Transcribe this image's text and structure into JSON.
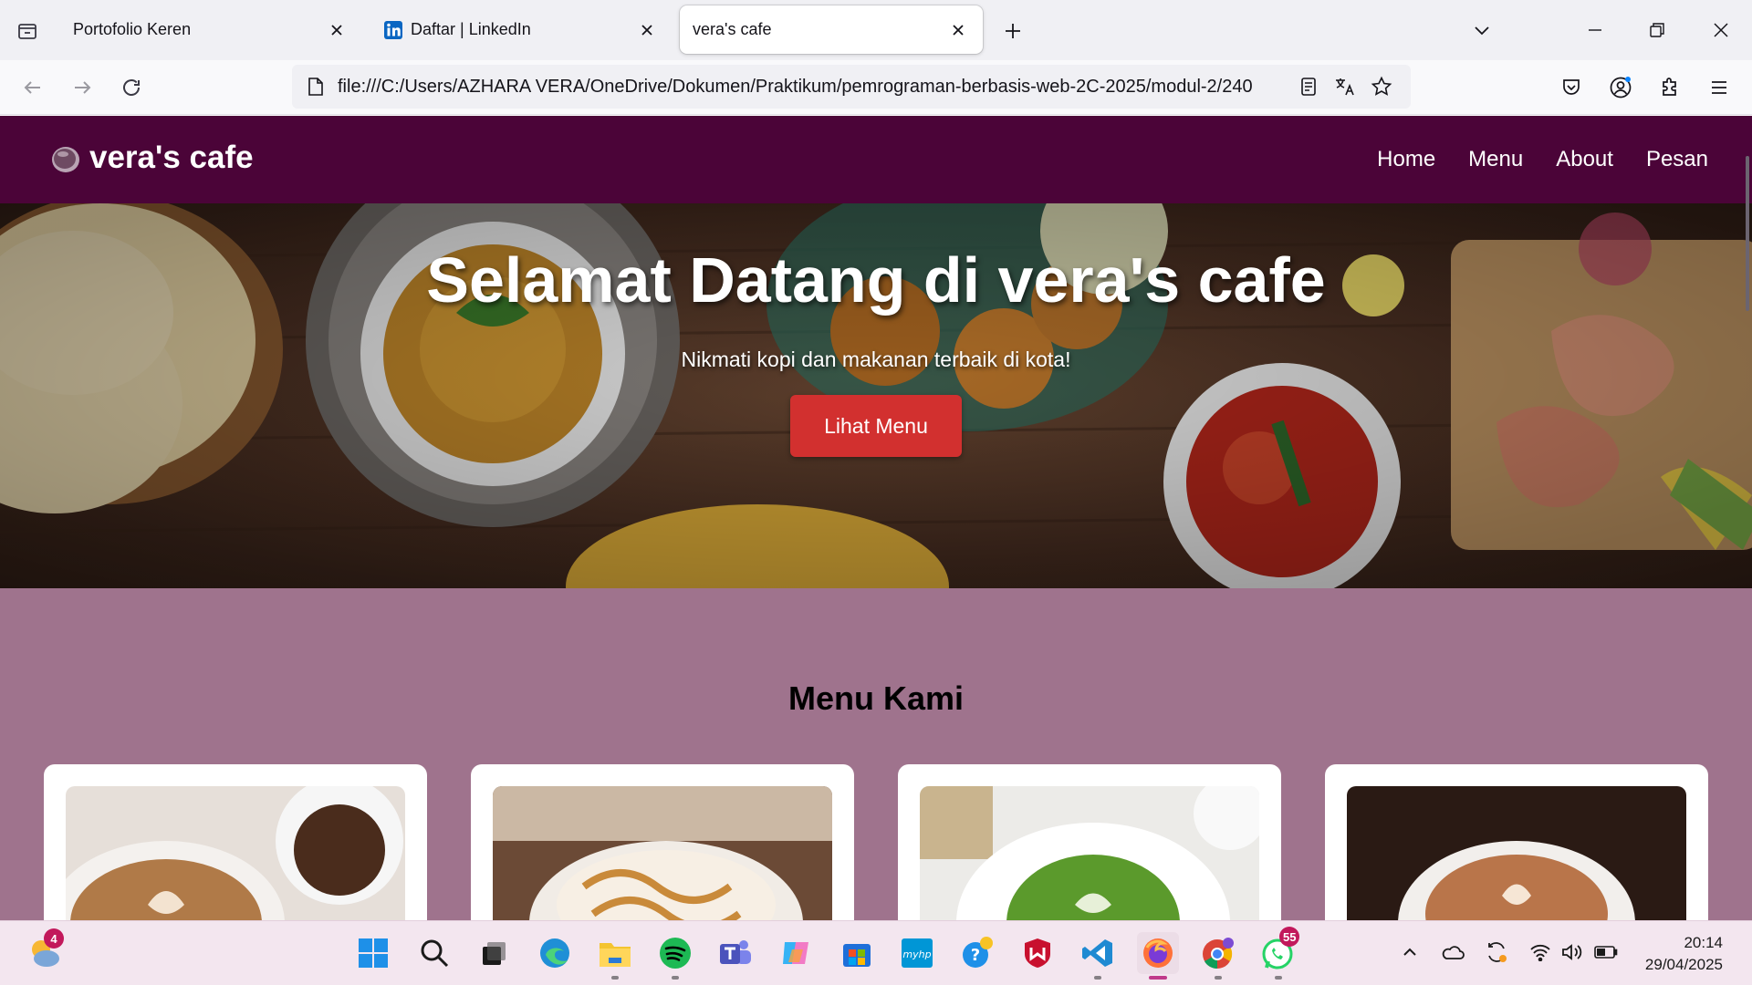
{
  "browser": {
    "tabs": [
      {
        "title": "Portofolio Keren",
        "active": false
      },
      {
        "title": "Daftar | LinkedIn",
        "active": false,
        "favicon": "linkedin-icon"
      },
      {
        "title": "vera's cafe",
        "active": true
      }
    ],
    "url": "file:///C:/Users/AZHARA VERA/OneDrive/Dokumen/Praktikum/pemrograman-berbasis-web-2C-2025/modul-2/240"
  },
  "site": {
    "brand": "vera's cafe",
    "nav": [
      "Home",
      "Menu",
      "About",
      "Pesan"
    ],
    "hero": {
      "title": "Selamat Datang di vera's cafe",
      "subtitle": "Nikmati kopi dan makanan terbaik di kota!",
      "button": "Lihat Menu"
    },
    "menu_title": "Menu Kami",
    "colors": {
      "header": "#4b0438",
      "section_bg": "#9f738d",
      "button": "#d2302f"
    }
  },
  "taskbar": {
    "weather_badge": "4",
    "whatsapp_badge": "55",
    "clock_time": "20:14",
    "clock_date": "29/04/2025"
  }
}
